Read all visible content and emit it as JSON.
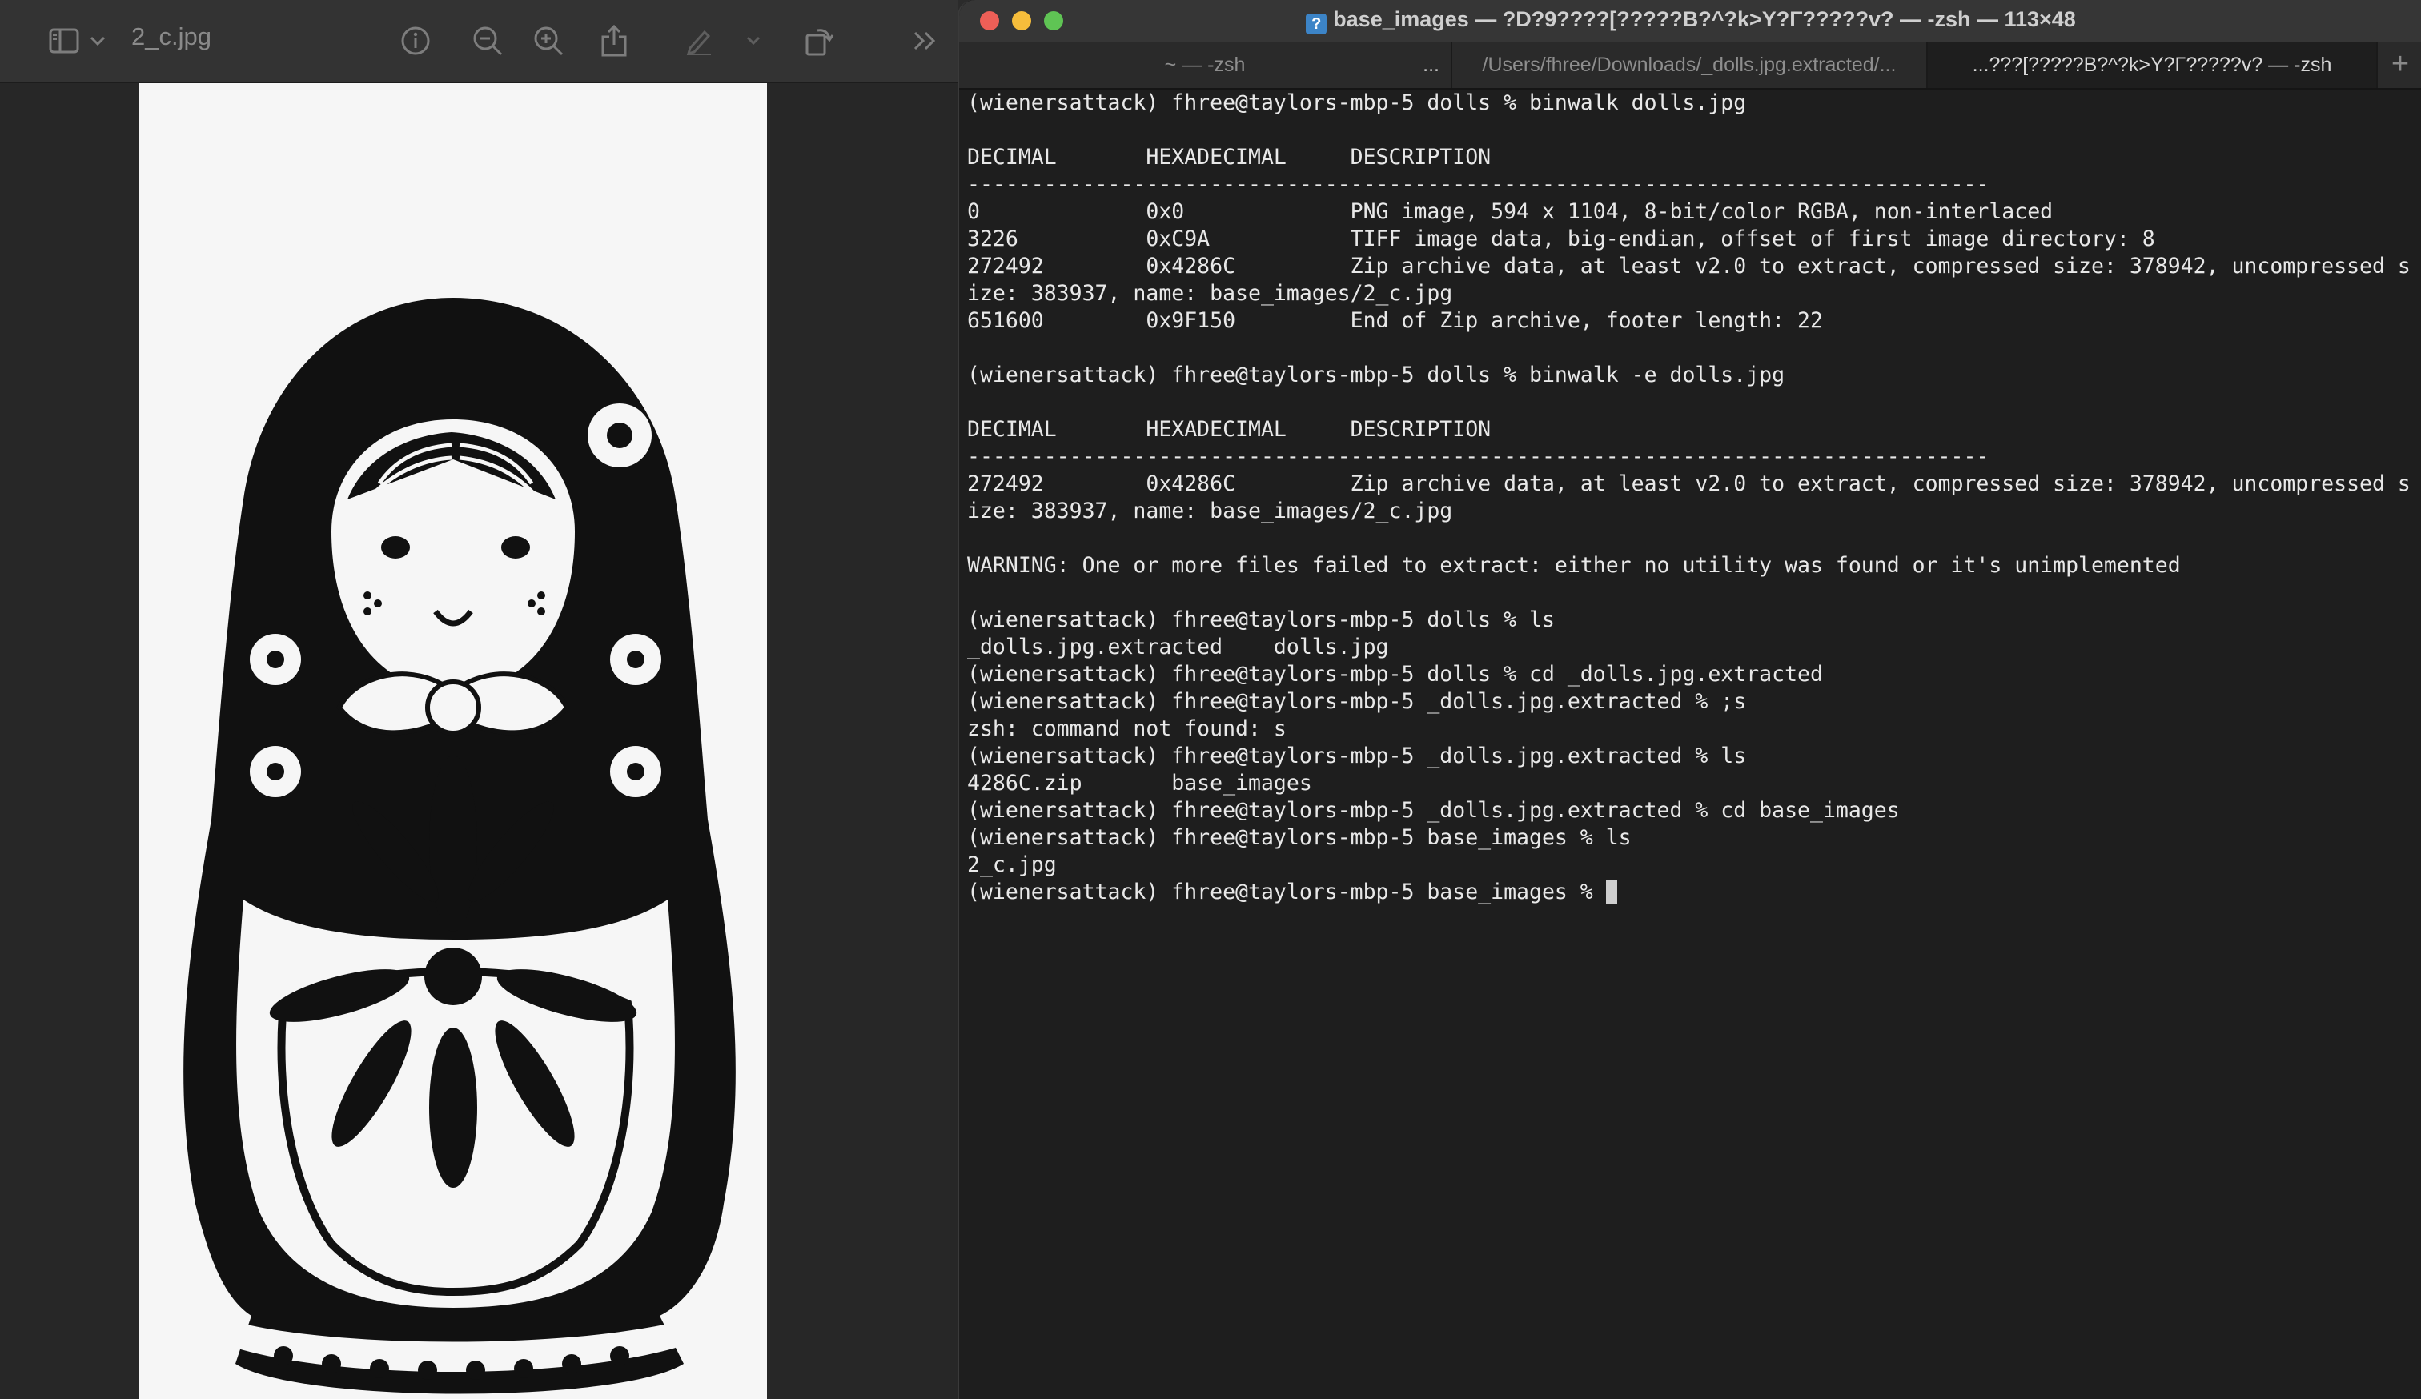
{
  "preview": {
    "filename": "2_c.jpg",
    "icons": [
      "sidebar-icon",
      "chevron-down-icon",
      "info-icon",
      "zoom-out-icon",
      "zoom-in-icon",
      "share-icon",
      "markup-pen-icon",
      "chevron-down-icon",
      "rotate-icon",
      "more-chevrons-icon"
    ]
  },
  "terminal": {
    "title": "base_images — ?D?9????[?????B?^?k>Y?Γ?????v? — -zsh — 113×48",
    "tabs": [
      {
        "label": "~ — -zsh",
        "more": "...",
        "active": false
      },
      {
        "label": "/Users/fhree/Downloads/_dolls.jpg.extracted/...",
        "active": false
      },
      {
        "label": "...???[?????B?^?k>Y?Γ?????v? — -zsh",
        "active": true
      }
    ],
    "tab_add": "+",
    "lines": [
      "(wienersattack) fhree@taylors-mbp-5 dolls % binwalk dolls.jpg",
      "",
      "DECIMAL       HEXADECIMAL     DESCRIPTION",
      "--------------------------------------------------------------------------------",
      "0             0x0             PNG image, 594 x 1104, 8-bit/color RGBA, non-interlaced",
      "3226          0xC9A           TIFF image data, big-endian, offset of first image directory: 8",
      "272492        0x4286C         Zip archive data, at least v2.0 to extract, compressed size: 378942, uncompressed s",
      "ize: 383937, name: base_images/2_c.jpg",
      "651600        0x9F150         End of Zip archive, footer length: 22",
      "",
      "(wienersattack) fhree@taylors-mbp-5 dolls % binwalk -e dolls.jpg",
      "",
      "DECIMAL       HEXADECIMAL     DESCRIPTION",
      "--------------------------------------------------------------------------------",
      "272492        0x4286C         Zip archive data, at least v2.0 to extract, compressed size: 378942, uncompressed s",
      "ize: 383937, name: base_images/2_c.jpg",
      "",
      "WARNING: One or more files failed to extract: either no utility was found or it's unimplemented",
      "",
      "(wienersattack) fhree@taylors-mbp-5 dolls % ls",
      "_dolls.jpg.extracted    dolls.jpg",
      "(wienersattack) fhree@taylors-mbp-5 dolls % cd _dolls.jpg.extracted",
      "(wienersattack) fhree@taylors-mbp-5 _dolls.jpg.extracted % ;s",
      "zsh: command not found: s",
      "(wienersattack) fhree@taylors-mbp-5 _dolls.jpg.extracted % ls",
      "4286C.zip       base_images",
      "(wienersattack) fhree@taylors-mbp-5 _dolls.jpg.extracted % cd base_images",
      "(wienersattack) fhree@taylors-mbp-5 base_images % ls",
      "2_c.jpg",
      "(wienersattack) fhree@taylors-mbp-5 base_images % "
    ]
  }
}
